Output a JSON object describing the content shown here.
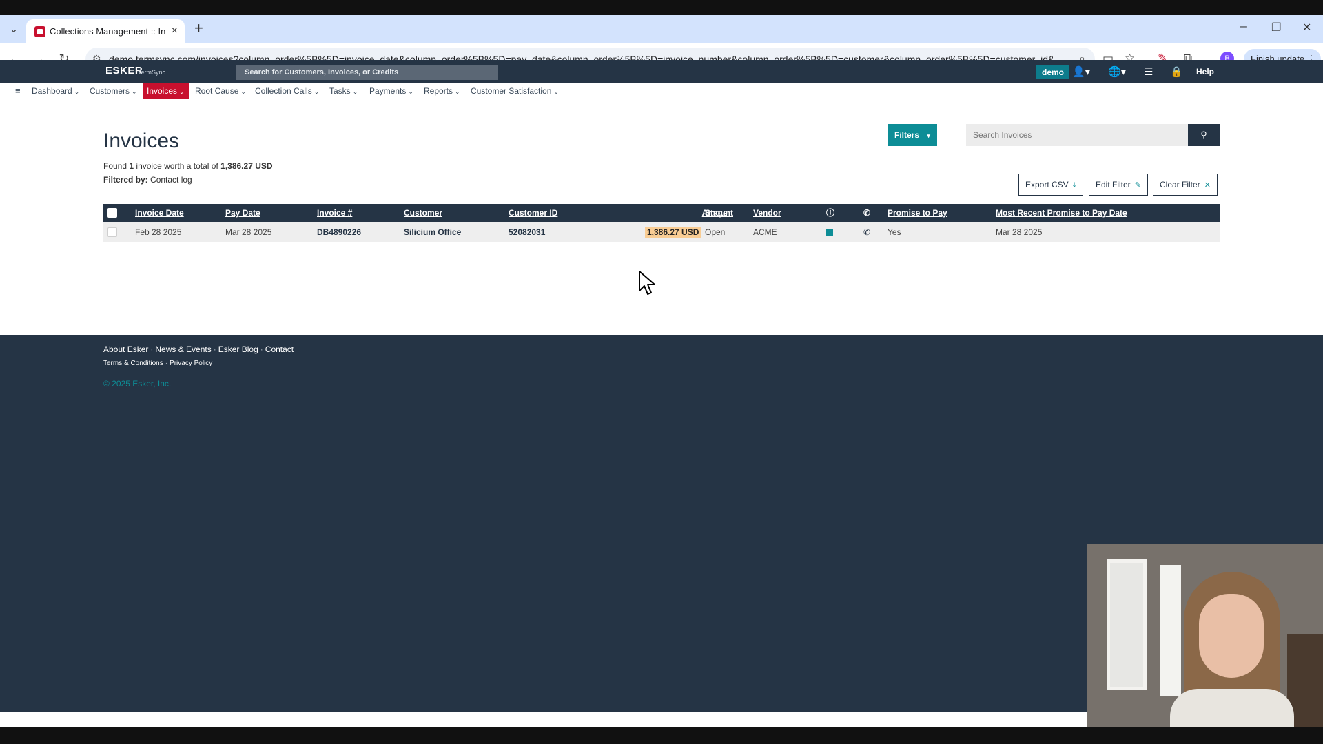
{
  "browser": {
    "tab_title": "Collections Management :: Invoices",
    "url": "demo.termsync.com/invoices?column_order%5B%5D=invoice_date&column_order%5B%5D=pay_date&column_order%5B%5D=invoice_number&column_order%5B%5D=customer&column_order%5B%5D=customer_id&colu...",
    "profile_initial": "B",
    "finish_update": "Finish update"
  },
  "header": {
    "logo": "ESKER",
    "logo_sub": "TermSync",
    "search_placeholder": "Search for Customers, Invoices, or Credits",
    "user_badge": "demo",
    "help": "Help"
  },
  "nav": {
    "items": [
      {
        "label": "Dashboard"
      },
      {
        "label": "Customers"
      },
      {
        "label": "Invoices",
        "active": true
      },
      {
        "label": "Root Cause"
      },
      {
        "label": "Collection Calls"
      },
      {
        "label": "Tasks"
      },
      {
        "label": "Payments"
      },
      {
        "label": "Reports"
      },
      {
        "label": "Customer Satisfaction"
      }
    ]
  },
  "page": {
    "title": "Invoices",
    "summary_prefix": "Found",
    "summary_count": "1",
    "summary_middle": "invoice worth a total of",
    "summary_total": "1,386.27 USD",
    "filtered_label": "Filtered by:",
    "filtered_value": "Contact log",
    "filters_button": "Filters",
    "search_placeholder": "Search Invoices",
    "export_csv": "Export CSV",
    "edit_filter": "Edit Filter",
    "clear_filter": "Clear Filter"
  },
  "table": {
    "columns": {
      "invoice_date": "Invoice Date",
      "pay_date": "Pay Date",
      "invoice_number": "Invoice #",
      "customer": "Customer",
      "customer_id": "Customer ID",
      "amount": "Amount",
      "stage": "Stage",
      "vendor": "Vendor",
      "promise_to_pay": "Promise to Pay",
      "recent_promise": "Most Recent Promise to Pay Date"
    },
    "rows": [
      {
        "invoice_date": "Feb 28 2025",
        "pay_date": "Mar 28 2025",
        "invoice_number": "DB4890226",
        "customer": "Silicium Office",
        "customer_id": "52082031",
        "amount": "1,386.27 USD",
        "stage": "Open",
        "vendor": "ACME",
        "promise_to_pay": "Yes",
        "recent_promise": "Mar 28 2025"
      }
    ]
  },
  "footer": {
    "links": [
      "About Esker",
      "News & Events",
      "Esker Blog",
      "Contact"
    ],
    "legal": [
      "Terms & Conditions",
      "Privacy Policy"
    ],
    "copyright": "© 2025 Esker, Inc."
  },
  "colors": {
    "header_bg": "#253445",
    "accent_teal": "#0d8d96",
    "active_nav": "#c8102e",
    "amount_highlight": "#f9cd94"
  }
}
